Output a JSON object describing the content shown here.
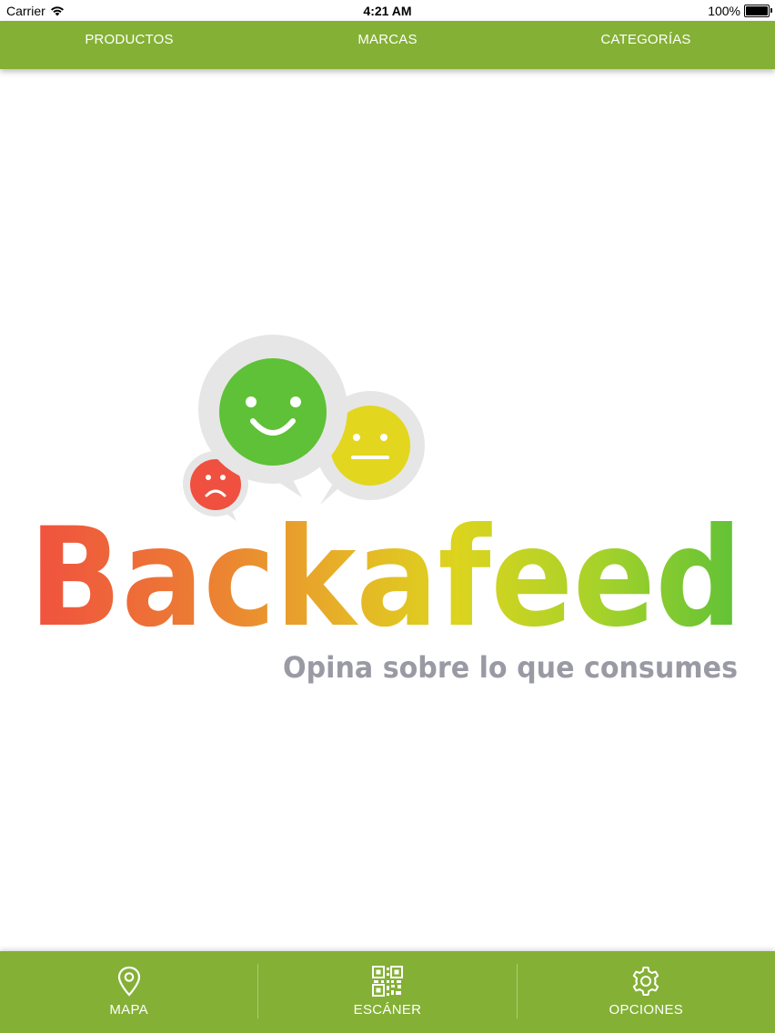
{
  "status_bar": {
    "carrier": "Carrier",
    "time": "4:21 AM",
    "battery": "100%"
  },
  "top_nav": {
    "tabs": [
      {
        "label": "PRODUCTOS"
      },
      {
        "label": "MARCAS"
      },
      {
        "label": "CATEGORÍAS"
      }
    ]
  },
  "logo": {
    "brand": "Backafeed",
    "tagline": "Opina sobre lo que consumes",
    "colors": {
      "green_face": "#5ec137",
      "yellow_face": "#e3d61e",
      "red_face": "#f0503f",
      "bubble": "#e6e6e6",
      "tagline": "#999aa3"
    }
  },
  "bottom_bar": {
    "items": [
      {
        "label": "MAPA",
        "icon": "map-pin-icon"
      },
      {
        "label": "ESCÁNER",
        "icon": "qr-code-icon"
      },
      {
        "label": "OPCIONES",
        "icon": "gear-icon"
      }
    ]
  },
  "theme": {
    "accent": "#84b035"
  }
}
